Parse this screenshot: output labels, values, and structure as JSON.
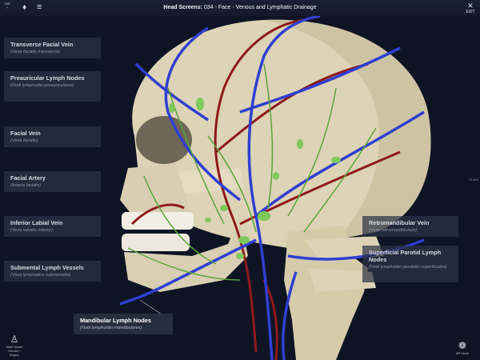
{
  "header": {
    "tab_label": "TAB",
    "title_bold": "Head Screens:",
    "title_rest": " 034 - Face - Venous and Lymphatic Drainage",
    "exit_label": "EXIT"
  },
  "labels_left": [
    {
      "name": "Transverse Facial Vein",
      "latin": "(Vena facialis transversa)"
    },
    {
      "name": "Preauricular Lymph Nodes",
      "latin": "(Nodi lymphoidei preauriculares)"
    },
    {
      "name": "Facial Vein",
      "latin": "(Vena facialis)"
    },
    {
      "name": "Facial Artery",
      "latin": "(Arteria facialis)"
    },
    {
      "name": "Inferior Labial Vein",
      "latin": "(Vena labialis inferior)"
    },
    {
      "name": "Submental Lymph Vessels",
      "latin": "(Vasa lymphatica submentalia)"
    }
  ],
  "label_active": {
    "name": "Mandibular Lymph Nodes",
    "latin": "(Nodi lymphoidei mandibulares)"
  },
  "labels_right": [
    {
      "name": "Retromandibular Vein",
      "latin": "(Vena retromandibularis)"
    },
    {
      "name": "Superficial Parotid Lymph Nodes",
      "latin": "(Nodi lymphoidei parotidei superficiales)"
    }
  ],
  "side_readout": "E-424",
  "footer": {
    "model_line1": "Male Model",
    "model_line2": "Gender / Region",
    "ar_label": "AR Mode"
  },
  "colors": {
    "vein": "#2f3fd0",
    "artery": "#8e1a1a",
    "lymph": "#5aa63a",
    "bone": "#ddd3b6"
  }
}
